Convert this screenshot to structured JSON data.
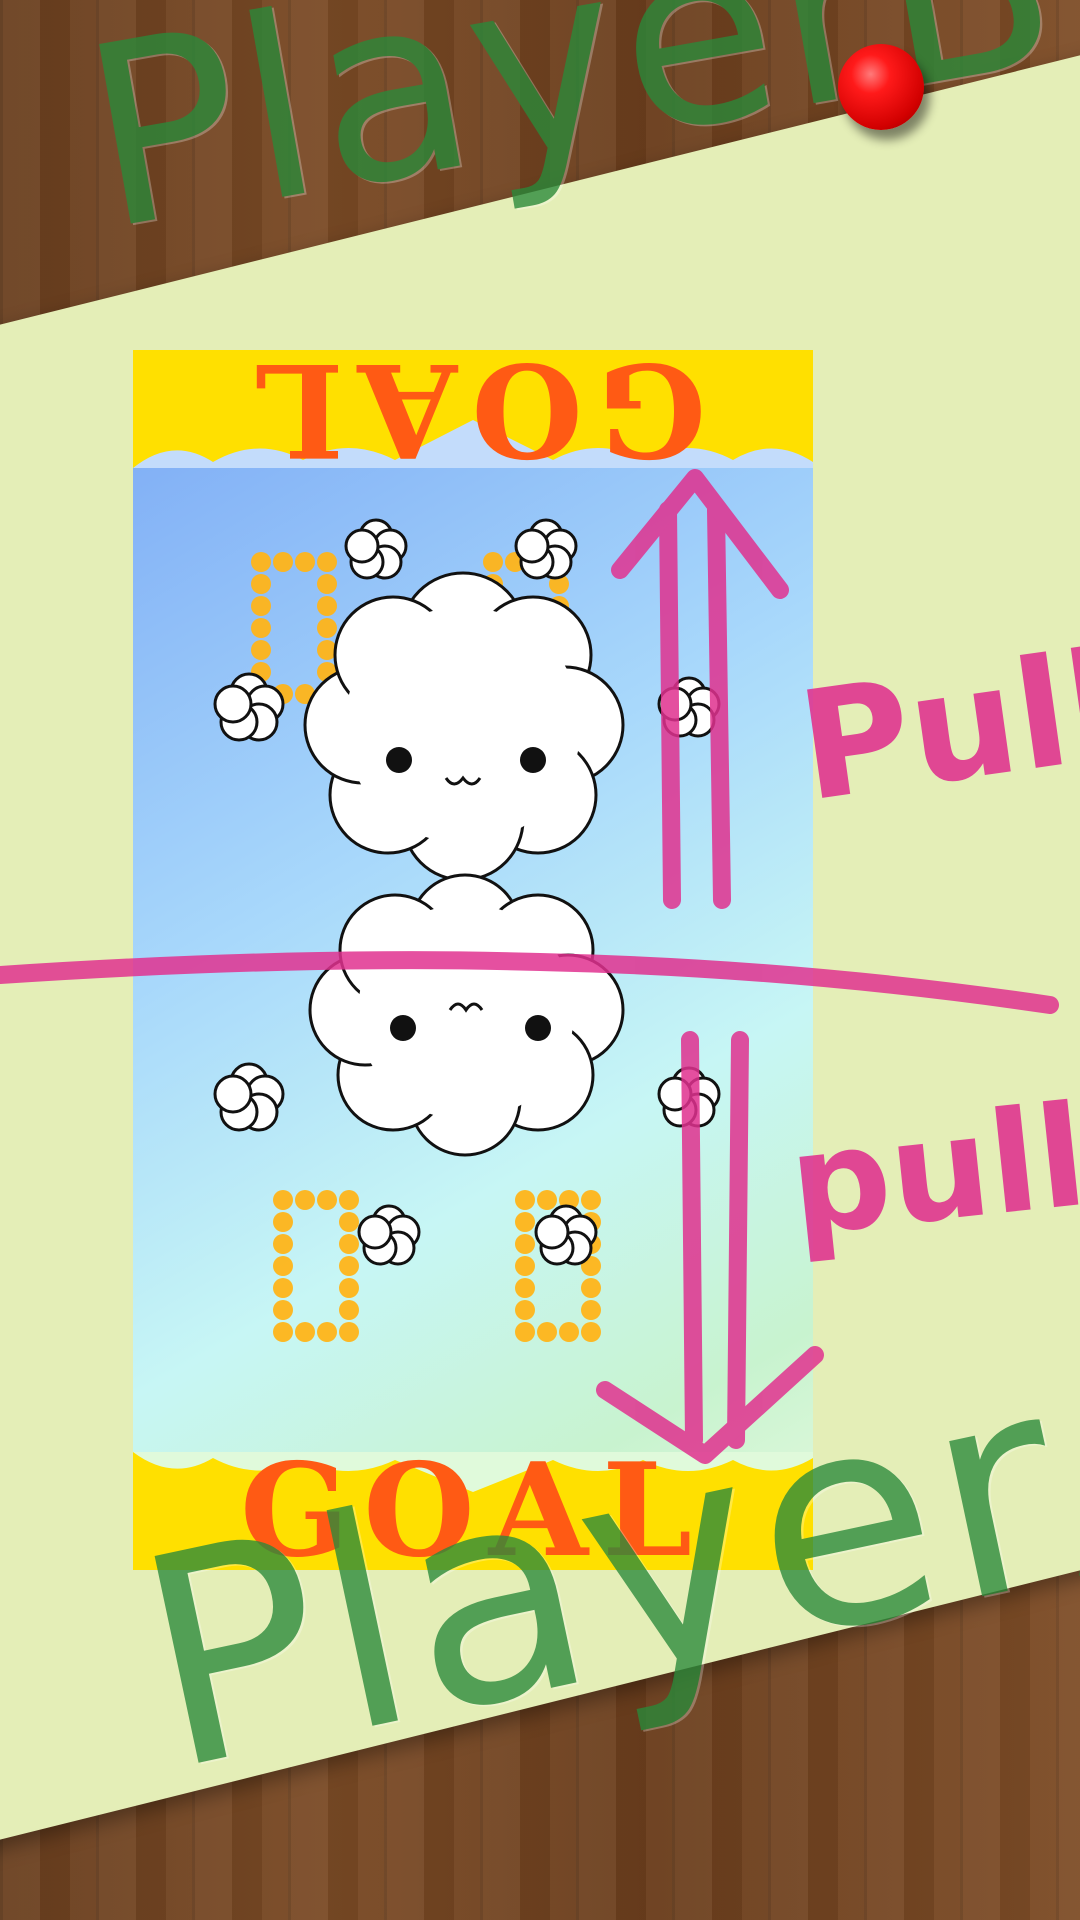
{
  "players": {
    "top": "PlayerB",
    "bottom": "PlayerA"
  },
  "goals": {
    "top": "GOAL",
    "bottom": "GOAL"
  },
  "instructions": {
    "top": "Pull",
    "bottom": "pull"
  },
  "scores": {
    "top": "0",
    "bottom": "0"
  },
  "colors": {
    "goal_band": "#ffe000",
    "goal_text": "#ff5a14",
    "chalk_pink": "#e0318f",
    "chalk_green": "#2a8a3a",
    "score_dots": "#ffb51a",
    "pin": "#ff1a1a"
  },
  "icons": {
    "pin": "red-pushpin-icon",
    "top_cloud": "happy-cloud-icon",
    "bottom_cloud": "happy-cloud-icon",
    "arrow_up": "double-arrow-up-icon",
    "arrow_down": "double-arrow-down-icon"
  }
}
